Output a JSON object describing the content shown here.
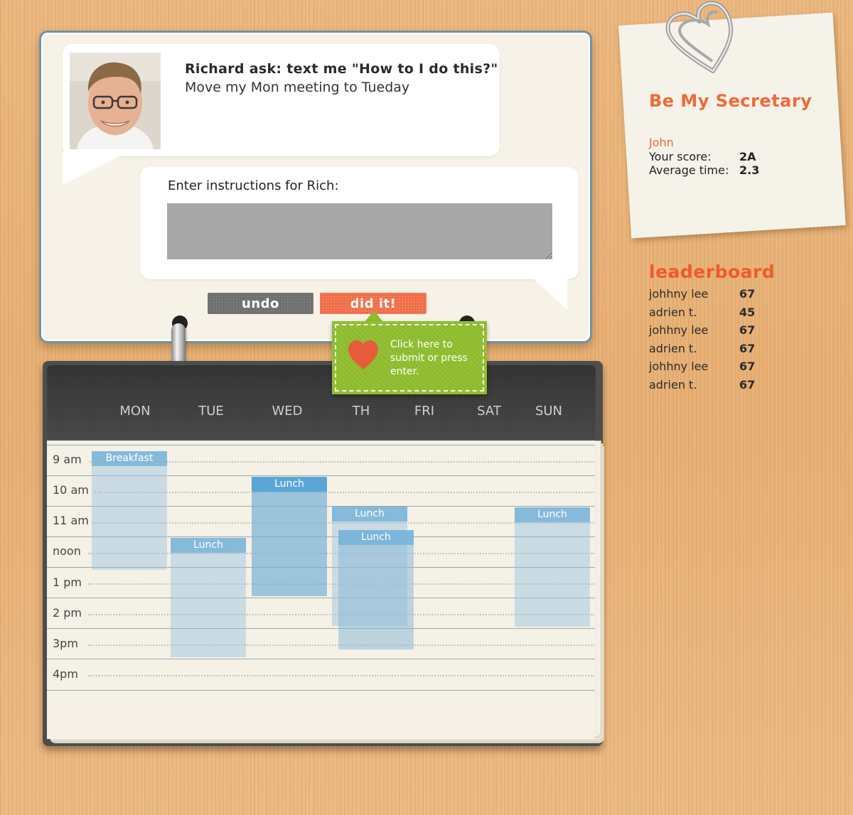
{
  "chat": {
    "title": "Richard ask: text me \"How to I do this?\"",
    "message": "Move my Mon meeting to Tueday",
    "instructions_label": "Enter instructions for Rich:",
    "instructions_value": "",
    "undo_label": "undo",
    "did_it_label": "did it!"
  },
  "tooltip": {
    "text": "Click here to submit or press enter.",
    "icon": "heart-icon"
  },
  "calendar": {
    "days": [
      "MON",
      "TUE",
      "WED",
      "TH",
      "FRI",
      "SAT",
      "SUN"
    ],
    "times": [
      "9 am",
      "10 am",
      "11 am",
      "noon",
      "1 pm",
      "2 pm",
      "3pm",
      "4pm"
    ],
    "events": [
      {
        "day": "MON",
        "label": "Breakfast"
      },
      {
        "day": "TUE",
        "label": "Lunch"
      },
      {
        "day": "WED",
        "label": "Lunch"
      },
      {
        "day": "TH",
        "label": "Lunch"
      },
      {
        "day": "TH",
        "label": "Lunch"
      },
      {
        "day": "SUN",
        "label": "Lunch"
      }
    ]
  },
  "sidebar": {
    "app_title": "Be My Secretary",
    "user_name": "John",
    "score_label": "Your score:",
    "score_value": "2A",
    "avg_label": "Average time:",
    "avg_value": "2.3",
    "clip_icon": "heart-paperclip-icon"
  },
  "leaderboard": {
    "title": "leaderboard",
    "entries": [
      {
        "name": "johhny lee",
        "score": "67"
      },
      {
        "name": "adrien t.",
        "score": "45"
      },
      {
        "name": "johhny lee",
        "score": "67"
      },
      {
        "name": "adrien t.",
        "score": "67"
      },
      {
        "name": "johhny lee",
        "score": "67"
      },
      {
        "name": "adrien t.",
        "score": "67"
      }
    ]
  },
  "colors": {
    "accent_orange": "#f06a36",
    "tooltip_green": "#8dbb2c",
    "event_blue": "#5aa7d6"
  }
}
